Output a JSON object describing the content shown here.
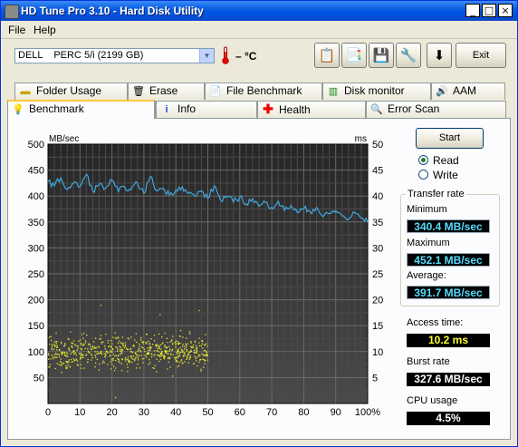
{
  "window": {
    "title": "HD Tune Pro 3.10 - Hard Disk Utility"
  },
  "menu": {
    "file": "File",
    "help": "Help"
  },
  "toolbar": {
    "drive": "DELL    PERC 5/i (2199 GB)",
    "temperature": "– °C",
    "exit": "Exit"
  },
  "tabs_top": [
    {
      "label": "Folder Usage",
      "icon": "folder-icon"
    },
    {
      "label": "Erase",
      "icon": "trash-icon"
    },
    {
      "label": "File Benchmark",
      "icon": "document-icon"
    },
    {
      "label": "Disk monitor",
      "icon": "monitor-chart-icon"
    },
    {
      "label": "AAM",
      "icon": "speaker-icon"
    }
  ],
  "tabs_bottom": [
    {
      "label": "Benchmark",
      "icon": "lightbulb-icon",
      "active": true
    },
    {
      "label": "Info",
      "icon": "info-icon"
    },
    {
      "label": "Health",
      "icon": "red-cross-icon"
    },
    {
      "label": "Error Scan",
      "icon": "magnifier-icon"
    }
  ],
  "controls": {
    "start": "Start",
    "read": "Read",
    "write": "Write",
    "selected": "Read"
  },
  "stats": {
    "transfer_rate": "Transfer rate",
    "minimum_label": "Minimum",
    "minimum": "340.4 MB/sec",
    "maximum_label": "Maximum",
    "maximum": "452.1 MB/sec",
    "average_label": "Average:",
    "average": "391.7 MB/sec",
    "access_label": "Access time:",
    "access": "10.2 ms",
    "burst_label": "Burst rate",
    "burst": "327.6 MB/sec",
    "cpu_label": "CPU usage",
    "cpu": "4.5%"
  },
  "colors": {
    "transfer_line": "#3fa8e0",
    "access_dots": "#e8e830",
    "plot_bg": "#2a2a2a"
  },
  "chart_data": {
    "type": "line",
    "left_axis_unit": "MB/sec",
    "right_axis_unit": "ms",
    "y_left_ticks": [
      "500",
      "450",
      "400",
      "350",
      "300",
      "250",
      "200",
      "150",
      "100",
      "50"
    ],
    "y_right_ticks": [
      "50",
      "45",
      "40",
      "35",
      "30",
      "25",
      "20",
      "15",
      "10",
      "5"
    ],
    "x_ticks": [
      "0",
      "10",
      "20",
      "30",
      "40",
      "50",
      "60",
      "70",
      "80",
      "90",
      "100%"
    ],
    "ylim_left": [
      0,
      500
    ],
    "ylim_right": [
      0,
      50
    ],
    "xlim": [
      0,
      100
    ],
    "grid": true,
    "series": [
      {
        "name": "",
        "kind": "line",
        "x": [
          0,
          2,
          4,
          6,
          8,
          10,
          12,
          14,
          16,
          18,
          20,
          22,
          24,
          26,
          28,
          30,
          32,
          34,
          36,
          38,
          40,
          42,
          44,
          46,
          48,
          50,
          52,
          54,
          56,
          58,
          60,
          62,
          64,
          66,
          68,
          70,
          72,
          74,
          76,
          78,
          80,
          82,
          84,
          86,
          88,
          90,
          92,
          94,
          96,
          98,
          100
        ],
        "y": [
          428,
          420,
          435,
          412,
          425,
          418,
          442,
          410,
          422,
          415,
          430,
          408,
          418,
          412,
          425,
          405,
          438,
          410,
          415,
          402,
          412,
          418,
          405,
          400,
          410,
          395,
          420,
          392,
          400,
          388,
          398,
          385,
          395,
          380,
          388,
          378,
          390,
          372,
          382,
          368,
          376,
          370,
          378,
          360,
          366,
          372,
          362,
          355,
          368,
          358,
          350
        ]
      },
      {
        "name": "",
        "kind": "scatter",
        "x_range": [
          0,
          50
        ],
        "y_range": [
          3,
          16
        ],
        "density": "dense cloud concentrated between 6 and 14 ms"
      }
    ]
  }
}
